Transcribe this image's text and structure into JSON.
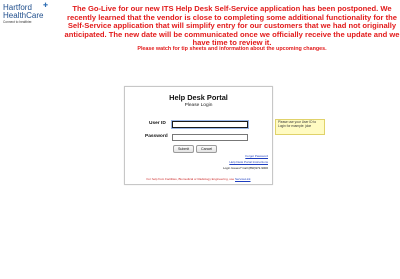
{
  "brand": {
    "line1": "Hartford",
    "line2": "HealthCare",
    "tagline": "Connect to healthier."
  },
  "announcement": {
    "main": "The Go-Live for our new ITS Help Desk Self-Service application has been postponed. We recently learned that the vendor is close to completing some additional functionality for the Self-Service application that will simplify entry for our customers that we had not originally anticipated. The new date will be communicated once we officially receive the update and we have time to review it.",
    "secondary": "Please watch for tip sheets and information about the upcoming changes."
  },
  "login": {
    "title": "Help Desk Portal",
    "subtitle": "Please Login",
    "user_id_label": "User ID",
    "password_label": "Password",
    "submit": "Submit",
    "cancel": "Cancel",
    "forgot_password": "Forgot Password",
    "instructions": "Help Desk Portal Instructions",
    "login_issues": "Login Issues? Call (860)972-9000",
    "footer_prefix": "For help from Facilities, Biomedical or Radiology Engineering, use ",
    "footer_link": "ServiceLink"
  },
  "tooltip": {
    "text": "Please use your User ID to Login for example: jdoe"
  }
}
